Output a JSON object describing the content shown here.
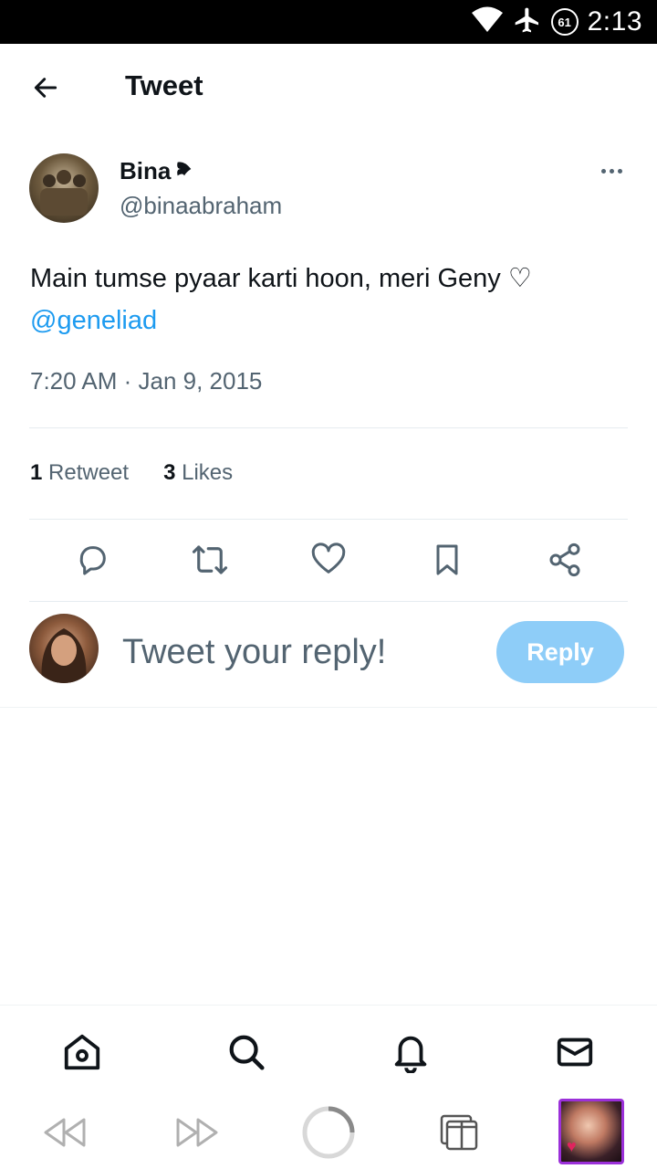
{
  "status_bar": {
    "time": "2:13",
    "battery_level": "61",
    "icons": [
      "wifi-icon",
      "airplane-icon",
      "battery-icon"
    ]
  },
  "header": {
    "title": "Tweet",
    "back_icon": "arrow-left-icon"
  },
  "tweet": {
    "author_name": "Bina",
    "author_handle": "@binaabraham",
    "text": "Main tumse pyaar karti hoon, meri Geny ♡",
    "mention": "@geneliad",
    "timestamp": "7:20 AM · Jan 9, 2015",
    "stats": {
      "retweets_count": "1",
      "retweets_label": "Retweet",
      "likes_count": "3",
      "likes_label": "Likes"
    },
    "actions": [
      "reply-icon",
      "retweet-icon",
      "like-icon",
      "bookmark-icon",
      "share-icon"
    ]
  },
  "composer": {
    "placeholder": "Tweet your reply!",
    "reply_label": "Reply"
  },
  "bottom_nav": [
    "home-icon",
    "search-icon",
    "notifications-icon",
    "messages-icon"
  ],
  "system_bar": [
    "rewind-icon",
    "fast-forward-icon",
    "loading-icon",
    "tabs-icon",
    "app-thumbnail"
  ],
  "colors": {
    "accent": "#1d9bf0",
    "reply_button": "#8ecdf8",
    "secondary_text": "#536471",
    "thumbnail_border": "#9b30d9"
  }
}
